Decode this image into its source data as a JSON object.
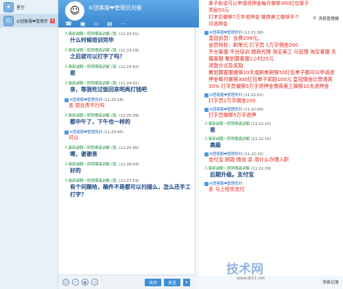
{
  "contacts": [
    {
      "name": "星空",
      "selected": false
    },
    {
      "name": "⑥团客服❤管理员",
      "selected": true
    }
  ],
  "header": {
    "title": "⑥团客服❤管理员刘备",
    "big_avatar": "☺"
  },
  "right_top": {
    "old_lines": [
      "单子和说可以申请退押金每月做够300红包单子",
      "奖励50元",
      "打字员做够7万字退押金 微商美工做够半个",
      "月退押金"
    ],
    "manager_label": "消息管理器"
  },
  "mid_messages": [
    {
      "sender": "人事部诚聘～阴阴哪森讲解",
      "suffix": "(我:",
      "time": "(11:23:01)",
      "color": "green",
      "text": "什么时候培训完毕",
      "style": "dark"
    },
    {
      "sender": "人事部诚聘～阴阴哪森讲解",
      "suffix": "(我:",
      "time": "(11:23:19)",
      "color": "green",
      "text": "之后就可以打字了吗？",
      "style": "dark"
    },
    {
      "sender": "人事部诚聘～阴阴哪森讲解",
      "suffix": "(我:",
      "time": "(11:23:42)",
      "color": "green",
      "text": "恩",
      "style": "dark"
    },
    {
      "sender": "人事部诚聘～阴阴哪森讲解",
      "suffix": "(我:",
      "time": "(11:24:51)",
      "color": "green",
      "text": "亲，等我吃过饭回来吧再打钱吧",
      "style": "dark"
    },
    {
      "sender": "⑥团客服❤管理员刘",
      "suffix": "",
      "time": "(11:25:18)",
      "color": "blue",
      "text": "亲 现在弄不行吗",
      "style": "red"
    },
    {
      "sender": "人事部诚聘～阴阴哪森讲解",
      "suffix": "(我:",
      "time": "(11:25:39)",
      "color": "green",
      "text": "都中午了，下午也一样的",
      "style": "dark"
    },
    {
      "sender": "⑥团客服❤管理员刘",
      "suffix": "",
      "time": "(11:25:45)",
      "color": "blue",
      "text": "可以",
      "style": "red"
    },
    {
      "sender": "人事部诚聘～阴阴哪森讲解",
      "suffix": "(我:",
      "time": "(11:25:56)",
      "color": "green",
      "text": "嗯，谢谢亲",
      "style": "dark"
    },
    {
      "sender": "人事部诚聘～阴阴哪森讲解",
      "suffix": "(我:",
      "time": "(11:26:04)",
      "color": "green",
      "text": "好的",
      "style": "dark"
    },
    {
      "sender": "人事部诚聘～阴阴哪森讲解",
      "suffix": "(我:",
      "time": "(11:27:53)",
      "color": "green",
      "text": "有个问题哈，稿件不是都可以扫描么，怎么还手工打字？",
      "style": "dark"
    }
  ],
  "right_messages": [
    {
      "sender": "⑥团客服❤管理员刘",
      "time": "(11:21:58)",
      "color": "blue",
      "text": "皇冠会员：会费299元。\n会员特权：刷单元 打字员 1万字佣金200\n平台客服 平台培训 微商代理 淘宝美工 马管理 淘宝客服 天猫客服 聚划算客服1小时25元\n退款方式及奖励\n聚划算客服做够10天或刷单刷够50红包单子都可以申请退押金每月做够300红包单子奖励100元 皇冠佣金比普通高30% 打字员做够5万字退押金微商美工做够10天退押金",
      "style": "red"
    },
    {
      "sender": "⑥团客服❤管理员刘",
      "time": "(11:22:01)",
      "color": "blue",
      "text": "打字员1万字佣金200",
      "style": "red"
    },
    {
      "sender": "⑥团客服❤管理员刘",
      "time": "(11:22:06)",
      "color": "blue",
      "text": "打字员做够5万字退押",
      "style": "red"
    },
    {
      "sender": "人事部诚聘～阴阴哪森讲解",
      "time": "(11:22:10)",
      "color": "green",
      "text": "恩",
      "style": "dark"
    },
    {
      "sender": "人事部诚聘～阴阴哪森讲解",
      "time": "(11:22:15)",
      "color": "green",
      "text": "高级",
      "style": "dark"
    },
    {
      "sender": "⑥团客服❤管理员刘",
      "time": "(11:22:22)",
      "color": "blue",
      "text": "支付宝 网银 微信 亲 用什么办理入职",
      "style": "red"
    },
    {
      "sender": "人事部诚聘～阴阴哪森讲解",
      "time": "(11:22:29)",
      "color": "green",
      "text": "后期升级。支付宝",
      "style": "dark"
    },
    {
      "sender": "⑥团客服❤管理员刘",
      "time": "",
      "color": "blue",
      "text": "亲 马上给你支付",
      "style": "red"
    }
  ],
  "bottom": {
    "close_label": "关闭",
    "send_label": "发送",
    "send_arrow": "▾",
    "records_label": "消息记录"
  },
  "watermark": {
    "main": "技术网",
    "small": "www.jb51.net"
  }
}
